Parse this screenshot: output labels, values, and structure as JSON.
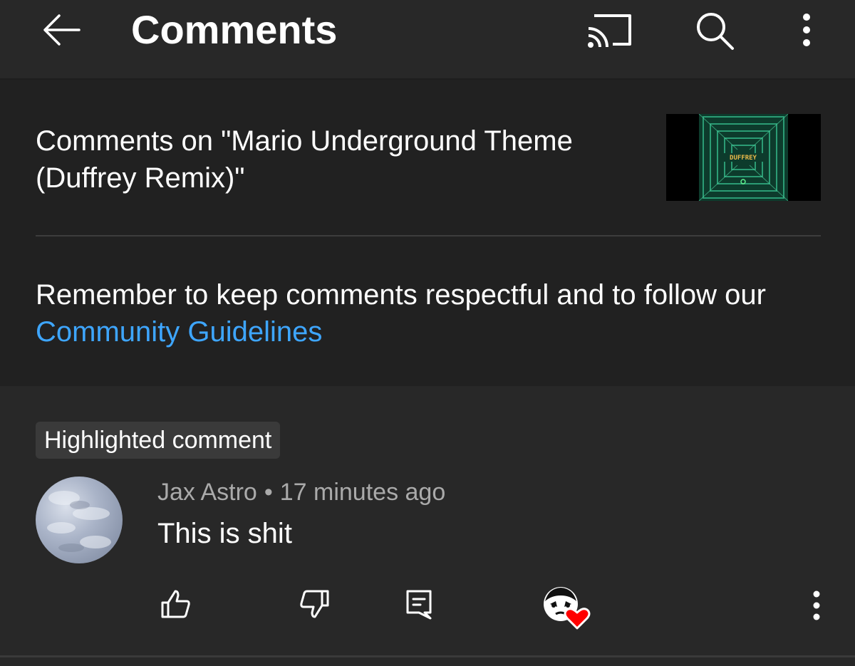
{
  "app": {
    "title": "Comments"
  },
  "toolbar": {
    "back_icon": "arrow-back-icon",
    "cast_icon": "cast-icon",
    "search_icon": "search-icon",
    "more_icon": "more-vert-icon"
  },
  "header": {
    "video_title": "Comments on \"Mario Underground Theme (Duffrey Remix)\"",
    "thumbnail_text": "DUFFREY",
    "guidelines_prefix": "Remember to keep comments respectful and to follow our ",
    "guidelines_link": "Community Guidelines"
  },
  "comment": {
    "badge": "Highlighted comment",
    "author": "Jax Astro",
    "separator": "•",
    "time": "17 minutes ago",
    "text": "This is shit",
    "actions": {
      "like_icon": "thumb-up-icon",
      "dislike_icon": "thumb-down-icon",
      "reply_icon": "reply-icon",
      "creator_heart_icon": "creator-heart-icon",
      "more_icon": "more-vert-icon"
    }
  },
  "colors": {
    "background": "#282828",
    "panel": "#212121",
    "link": "#3ea6ff",
    "secondary_text": "#aaaaaa",
    "heart": "#ff0000"
  }
}
